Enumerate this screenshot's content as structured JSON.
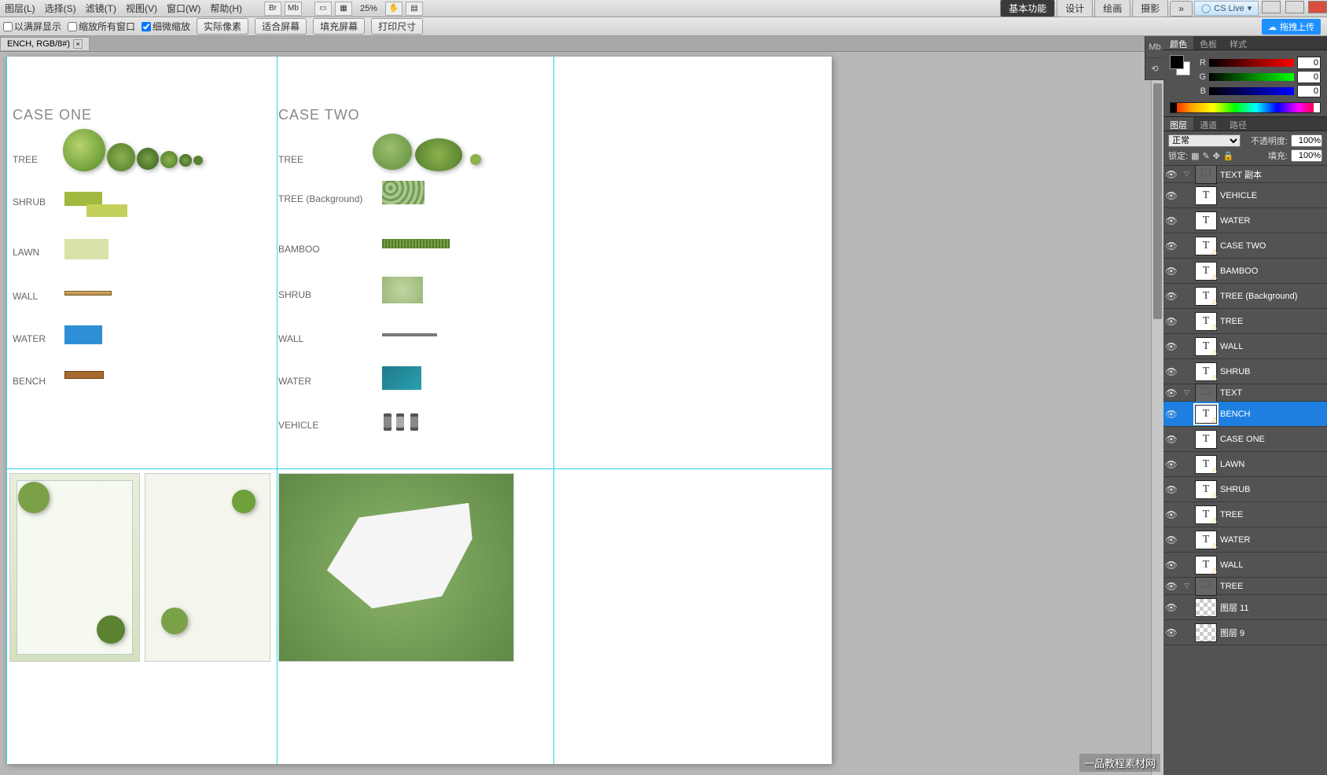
{
  "menubar": {
    "items": [
      "图层(L)",
      "选择(S)",
      "滤镜(T)",
      "视图(V)",
      "窗口(W)",
      "帮助(H)"
    ],
    "zoom": "25%",
    "workspace_tabs": [
      "基本功能",
      "设计",
      "绘画",
      "摄影"
    ],
    "more": "»",
    "cslive": "CS Live",
    "upload": "拖拽上传"
  },
  "optbar": {
    "chk1": "以满屏显示",
    "chk2": "缩放所有窗口",
    "chk3": "细微缩放",
    "b1": "实际像素",
    "b2": "适合屏幕",
    "b3": "填充屏幕",
    "b4": "打印尺寸"
  },
  "doctab": "ENCH, RGB/8#)",
  "canvas": {
    "case1_title": "CASE ONE",
    "case2_title": "CASE TWO",
    "case1_rows": [
      "TREE",
      "SHRUB",
      "LAWN",
      "WALL",
      "WATER",
      "BENCH"
    ],
    "case2_rows": [
      "TREE",
      "TREE (Background)",
      "BAMBOO",
      "SHRUB",
      "WALL",
      "WATER",
      "VEHICLE"
    ]
  },
  "color_panel": {
    "tabs": [
      "颜色",
      "色板",
      "样式"
    ],
    "r": "0",
    "g": "0",
    "b": "0"
  },
  "layers_panel": {
    "tabs": [
      "图层",
      "通道",
      "路径"
    ],
    "blend": "正常",
    "opacity_label": "不透明度:",
    "opacity": "100%",
    "lock_label": "锁定:",
    "fill_label": "填充:",
    "fill": "100%",
    "items": [
      {
        "type": "group",
        "name": "TEXT 副本",
        "indent": 0,
        "open": true
      },
      {
        "type": "text",
        "name": "VEHICLE",
        "indent": 1,
        "warn": false
      },
      {
        "type": "text",
        "name": "WATER",
        "indent": 1,
        "warn": false
      },
      {
        "type": "text",
        "name": "CASE TWO",
        "indent": 1,
        "warn": true
      },
      {
        "type": "text",
        "name": "BAMBOO",
        "indent": 1,
        "warn": true
      },
      {
        "type": "text",
        "name": "TREE (Background)",
        "indent": 1,
        "warn": true
      },
      {
        "type": "text",
        "name": "TREE",
        "indent": 1,
        "warn": true
      },
      {
        "type": "text",
        "name": "WALL",
        "indent": 1,
        "warn": true
      },
      {
        "type": "text",
        "name": "SHRUB",
        "indent": 1,
        "warn": true
      },
      {
        "type": "group",
        "name": "TEXT",
        "indent": 0,
        "open": true
      },
      {
        "type": "text",
        "name": "BENCH",
        "indent": 1,
        "warn": true,
        "selected": true
      },
      {
        "type": "text",
        "name": "CASE ONE",
        "indent": 1,
        "warn": false
      },
      {
        "type": "text",
        "name": "LAWN",
        "indent": 1,
        "warn": true
      },
      {
        "type": "text",
        "name": "SHRUB",
        "indent": 1,
        "warn": true
      },
      {
        "type": "text",
        "name": "TREE",
        "indent": 1,
        "warn": true
      },
      {
        "type": "text",
        "name": "WATER",
        "indent": 1,
        "warn": true
      },
      {
        "type": "text",
        "name": "WALL",
        "indent": 1,
        "warn": true
      },
      {
        "type": "group",
        "name": "TREE",
        "indent": 0,
        "open": true
      },
      {
        "type": "raster",
        "name": "图层 11",
        "indent": 1
      },
      {
        "type": "raster",
        "name": "图层 9",
        "indent": 1
      }
    ]
  },
  "watermark": "一品教程素材网"
}
